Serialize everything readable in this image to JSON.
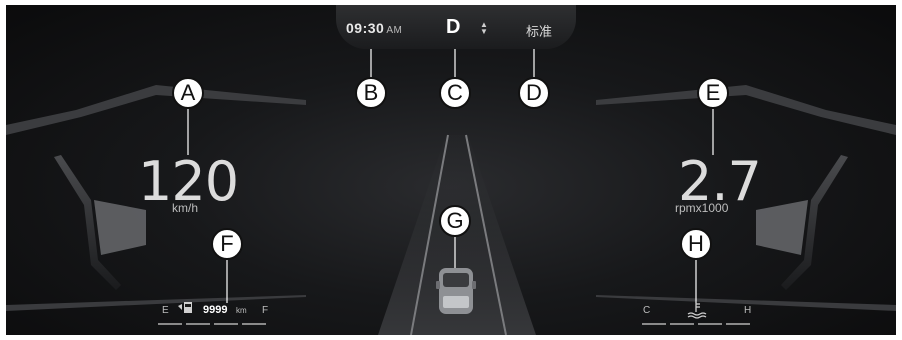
{
  "header": {
    "time": "09:30",
    "ampm": "AM",
    "gear": "D",
    "drive_mode": "标准"
  },
  "speed": {
    "value": "120",
    "unit": "km/h"
  },
  "tachometer": {
    "value": "2.7",
    "unit": "rpmx1000"
  },
  "fuel": {
    "empty_label": "E",
    "full_label": "F",
    "range": "9999",
    "range_unit": "km"
  },
  "coolant": {
    "cold_label": "C",
    "hot_label": "H"
  },
  "callouts": {
    "a": "A",
    "b": "B",
    "c": "C",
    "d": "D",
    "e": "E",
    "f": "F",
    "g": "G",
    "h": "H"
  },
  "icons": [
    "fuel-pump-icon",
    "coolant-temperature-icon",
    "gear-arrows-icon",
    "car-icon"
  ]
}
